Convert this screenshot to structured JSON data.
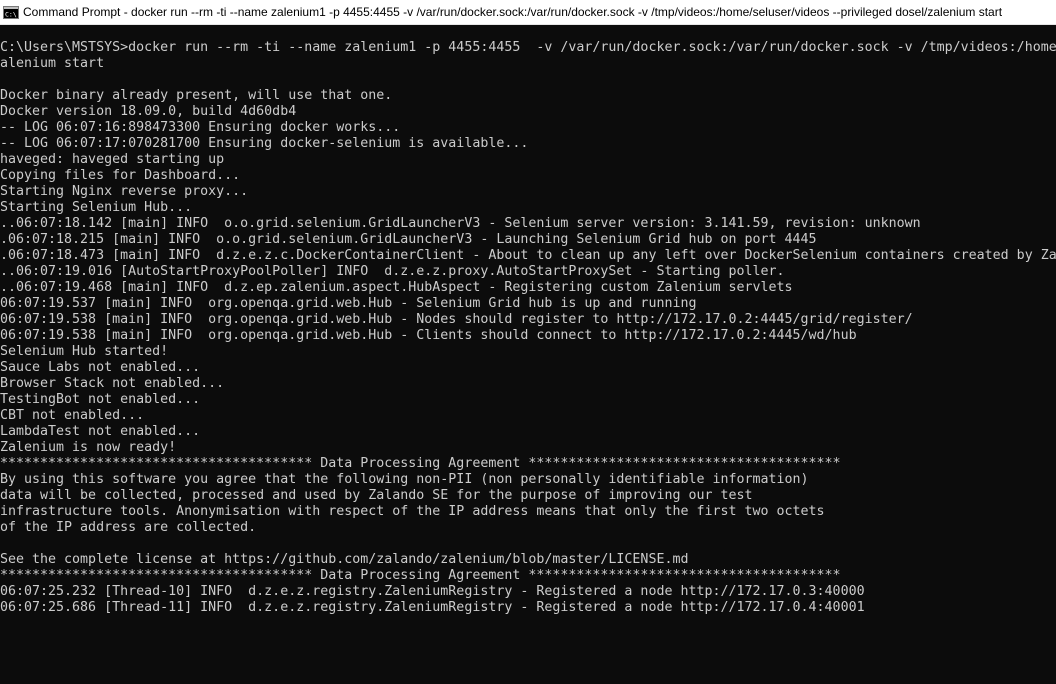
{
  "window": {
    "title": "Command Prompt - docker  run --rm -ti --name zalenium1 -p 4455:4455  -v /var/run/docker.sock:/var/run/docker.sock -v /tmp/videos:/home/seluser/videos --privileged dosel/zalenium start",
    "icon": "command-prompt-icon"
  },
  "colors": {
    "console_background": "#0c0c0c",
    "console_text": "#cccccc",
    "titlebar_background": "#ffffff"
  },
  "console": {
    "lines": [
      "C:\\Users\\MSTSYS>docker run --rm -ti --name zalenium1 -p 4455:4455  -v /var/run/docker.sock:/var/run/docker.sock -v /tmp/videos:/home",
      "alenium start",
      "",
      "Docker binary already present, will use that one.",
      "Docker version 18.09.0, build 4d60db4",
      "-- LOG 06:07:16:898473300 Ensuring docker works...",
      "-- LOG 06:07:17:070281700 Ensuring docker-selenium is available...",
      "haveged: haveged starting up",
      "Copying files for Dashboard...",
      "Starting Nginx reverse proxy...",
      "Starting Selenium Hub...",
      "..06:07:18.142 [main] INFO  o.o.grid.selenium.GridLauncherV3 - Selenium server version: 3.141.59, revision: unknown",
      ".06:07:18.215 [main] INFO  o.o.grid.selenium.GridLauncherV3 - Launching Selenium Grid hub on port 4445",
      ".06:07:18.473 [main] INFO  d.z.e.z.c.DockerContainerClient - About to clean up any left over DockerSelenium containers created by Za",
      "..06:07:19.016 [AutoStartProxyPoolPoller] INFO  d.z.e.z.proxy.AutoStartProxySet - Starting poller.",
      "..06:07:19.468 [main] INFO  d.z.ep.zalenium.aspect.HubAspect - Registering custom Zalenium servlets",
      "06:07:19.537 [main] INFO  org.openqa.grid.web.Hub - Selenium Grid hub is up and running",
      "06:07:19.538 [main] INFO  org.openqa.grid.web.Hub - Nodes should register to http://172.17.0.2:4445/grid/register/",
      "06:07:19.538 [main] INFO  org.openqa.grid.web.Hub - Clients should connect to http://172.17.0.2:4445/wd/hub",
      "Selenium Hub started!",
      "Sauce Labs not enabled...",
      "Browser Stack not enabled...",
      "TestingBot not enabled...",
      "CBT not enabled...",
      "LambdaTest not enabled...",
      "Zalenium is now ready!",
      "*************************************** Data Processing Agreement ***************************************",
      "By using this software you agree that the following non-PII (non personally identifiable information)",
      "data will be collected, processed and used by Zalando SE for the purpose of improving our test",
      "infrastructure tools. Anonymisation with respect of the IP address means that only the first two octets",
      "of the IP address are collected.",
      "",
      "See the complete license at https://github.com/zalando/zalenium/blob/master/LICENSE.md",
      "*************************************** Data Processing Agreement ***************************************",
      "06:07:25.232 [Thread-10] INFO  d.z.e.z.registry.ZaleniumRegistry - Registered a node http://172.17.0.3:40000",
      "06:07:25.686 [Thread-11] INFO  d.z.e.z.registry.ZaleniumRegistry - Registered a node http://172.17.0.4:40001"
    ]
  }
}
